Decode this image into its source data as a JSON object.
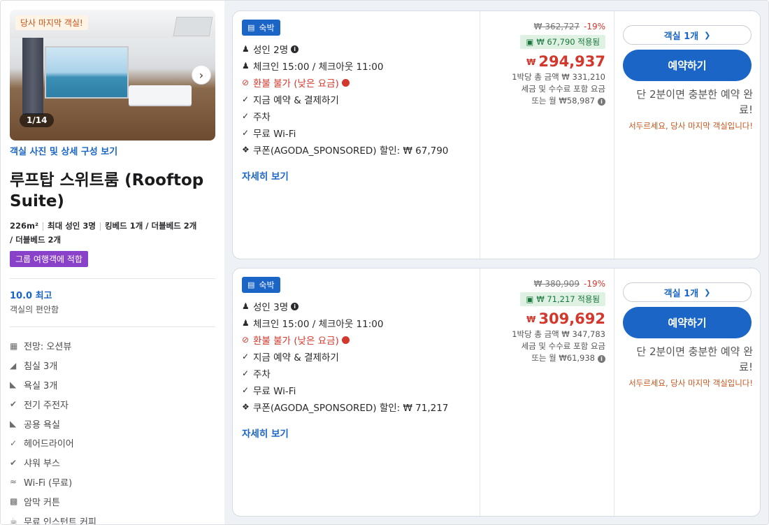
{
  "left": {
    "last_room_badge": "당사 마지막 객실!",
    "photo_counter": "1/14",
    "view_photos_link": "객실 사진 및 상세 구성 보기",
    "room_title": "루프탑 스위트룸 (Rooftop Suite)",
    "specs": {
      "size": "226m²",
      "max_guests": "최대 성인 3명",
      "beds_line1": "킹베드 1개 / 더블베드 2개",
      "beds_line2": "/ 더블베드 2개"
    },
    "group_badge": "그룹 여행객에 적합",
    "score": "10.0 최고",
    "score_sub": "객실의 편안함",
    "amenities": [
      {
        "icon": "view-icon",
        "label": "전망: 오션뷰"
      },
      {
        "icon": "bedroom-icon",
        "label": "침실 3개"
      },
      {
        "icon": "bathtub-icon",
        "label": "욕실 3개"
      },
      {
        "icon": "check-circle-icon",
        "label": "전기 주전자"
      },
      {
        "icon": "bathtub-icon",
        "label": "공용 욕실"
      },
      {
        "icon": "check-icon",
        "label": "헤어드라이어"
      },
      {
        "icon": "check-circle-icon",
        "label": "샤워 부스"
      },
      {
        "icon": "wifi-icon",
        "label": "Wi-Fi (무료)"
      },
      {
        "icon": "curtain-icon",
        "label": "암막 커튼"
      },
      {
        "icon": "coffee-icon",
        "label": "무료 인스턴트 커피"
      }
    ]
  },
  "offers": [
    {
      "stay_badge": "숙박",
      "guests": "성인 2명",
      "checkin": "체크인 15:00 / 체크아웃 11:00",
      "refund": "환불 불가 (낮은 요금)",
      "pay_now": "지금 예약 & 결제하기",
      "parking": "주차",
      "wifi": "무료 Wi-Fi",
      "coupon": "쿠폰(AGODA_SPONSORED) 할인: ₩ 67,790",
      "details_link": "자세히 보기",
      "original_price": "₩ 362,727",
      "discount_pct": "-19%",
      "coupon_applied": "₩ 67,790 적용됨",
      "currency": "₩",
      "price": "294,937",
      "total_note": "1박당 총 금액 ₩ 331,210",
      "tax_note": "세금 및 수수료 포함 요금",
      "monthly_note": "또는 월 ₩58,987",
      "qty_label": "객실 1개",
      "book_label": "예약하기",
      "easy_msg": "단 2분이면 충분한 예약 완료!",
      "hurry_msg": "서두르세요, 당사 마지막 객실입니다!"
    },
    {
      "stay_badge": "숙박",
      "guests": "성인 3명",
      "checkin": "체크인 15:00 / 체크아웃 11:00",
      "refund": "환불 불가 (낮은 요금)",
      "pay_now": "지금 예약 & 결제하기",
      "parking": "주차",
      "wifi": "무료 Wi-Fi",
      "coupon": "쿠폰(AGODA_SPONSORED) 할인: ₩ 71,217",
      "details_link": "자세히 보기",
      "original_price": "₩ 380,909",
      "discount_pct": "-19%",
      "coupon_applied": "₩ 71,217 적용됨",
      "currency": "₩",
      "price": "309,692",
      "total_note": "1박당 총 금액 ₩ 347,783",
      "tax_note": "세금 및 수수료 포함 요금",
      "monthly_note": "또는 월 ₩61,938",
      "qty_label": "객실 1개",
      "book_label": "예약하기",
      "easy_msg": "단 2분이면 충분한 예약 완료!",
      "hurry_msg": "서두르세요, 당사 마지막 객실입니다!"
    }
  ],
  "colors": {
    "accent_blue": "#1a65c6",
    "price_red": "#d4382c",
    "urgent_orange": "#c8541a",
    "group_purple": "#8a41c9",
    "coupon_green": "#15763a"
  }
}
